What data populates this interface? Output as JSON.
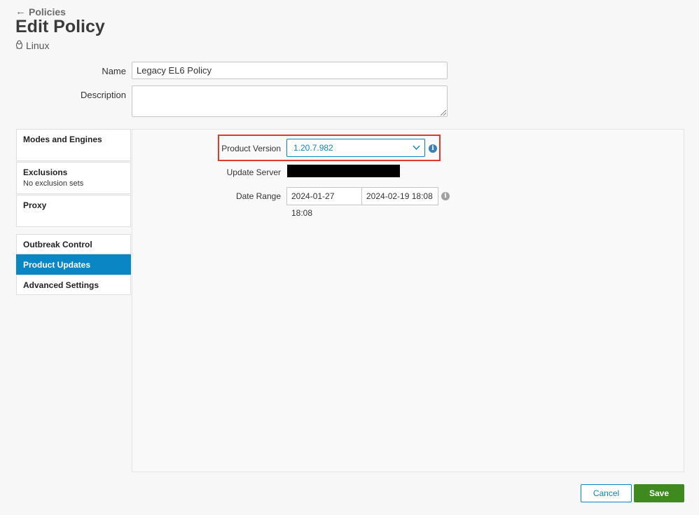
{
  "header": {
    "back_label": "Policies",
    "title": "Edit Policy",
    "os_label": "Linux"
  },
  "form": {
    "name_label": "Name",
    "name_value": "Legacy EL6 Policy",
    "description_label": "Description",
    "description_value": ""
  },
  "sidebar": {
    "items": [
      {
        "label": "Modes and Engines",
        "sub": ""
      },
      {
        "label": "Exclusions",
        "sub": "No exclusion sets"
      },
      {
        "label": "Proxy",
        "sub": ""
      },
      {
        "label": "Outbreak Control",
        "sub": ""
      },
      {
        "label": "Product Updates",
        "sub": "",
        "active": true
      },
      {
        "label": "Advanced Settings",
        "sub": ""
      }
    ]
  },
  "product_updates": {
    "product_version_label": "Product Version",
    "product_version_value": "1.20.7.982",
    "update_server_label": "Update Server",
    "date_range_label": "Date Range",
    "date_from": "2024-01-27 18:08",
    "date_to": "2024-02-19 18:08"
  },
  "actions": {
    "cancel_label": "Cancel",
    "save_label": "Save"
  },
  "colors": {
    "accent": "#0a86c4",
    "save": "#3e8a1f",
    "highlight": "#e03a2a"
  },
  "icons": {
    "back": "arrow-left-icon",
    "os": "linux-penguin-icon",
    "dropdown": "chevron-down-icon",
    "info": "info-icon"
  }
}
